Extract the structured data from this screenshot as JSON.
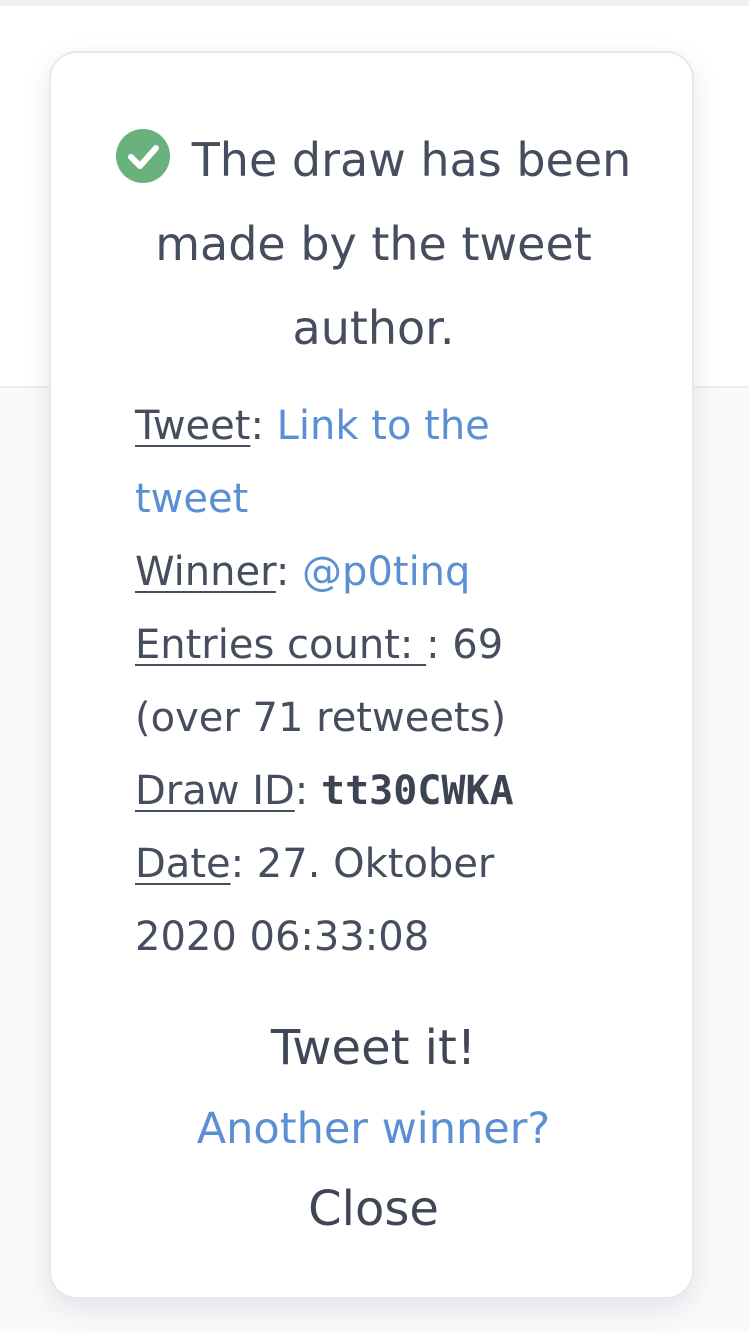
{
  "dialog": {
    "headline": "The draw has been made by the tweet author.",
    "success_color": "#6ab27d",
    "link_color": "#5b8fd3",
    "fields": {
      "tweet_label": "Tweet",
      "tweet_link": "Link to the tweet",
      "winner_label": "Winner",
      "winner_handle": "@p0tinq",
      "entries_label": "Entries count: ",
      "entries_value": ": 69 (over 71 retweets)",
      "draw_id_label": "Draw ID",
      "draw_id_value": "tt30CWKA",
      "date_label": "Date",
      "date_value": ": 27. Oktober 2020 06:33:08"
    },
    "separator": ": ",
    "actions": {
      "tweet_it": "Tweet it!",
      "another_winner": "Another winner?",
      "close": "Close"
    }
  }
}
